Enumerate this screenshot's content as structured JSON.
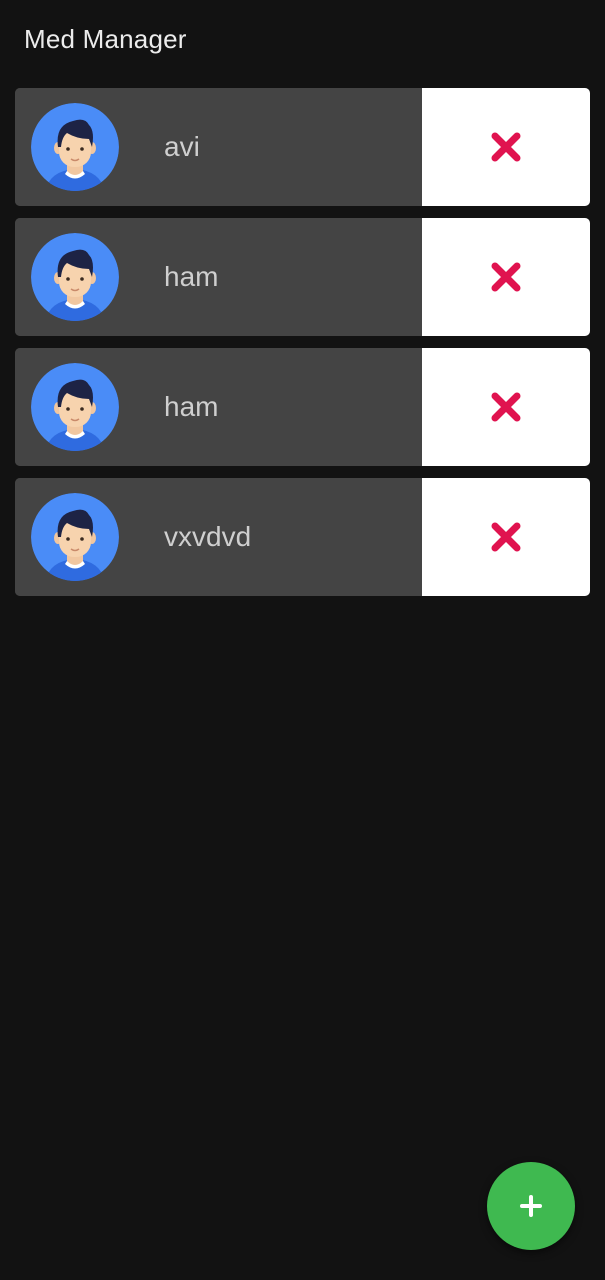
{
  "app": {
    "title": "Med Manager"
  },
  "colors": {
    "background": "#121212",
    "card": "#444444",
    "action_bg": "#ffffff",
    "delete_icon": "#e0134f",
    "fab": "#3fb950",
    "avatar_bg": "#4a8cf7"
  },
  "patients": [
    {
      "name": "avi",
      "avatar_icon": "person-avatar-icon",
      "action_icon": "delete-x-icon"
    },
    {
      "name": "ham",
      "avatar_icon": "person-avatar-icon",
      "action_icon": "delete-x-icon"
    },
    {
      "name": "ham",
      "avatar_icon": "person-avatar-icon",
      "action_icon": "delete-x-icon"
    },
    {
      "name": "vxvdvd",
      "avatar_icon": "person-avatar-icon",
      "action_icon": "delete-x-icon"
    }
  ],
  "fab": {
    "icon": "plus-icon"
  }
}
